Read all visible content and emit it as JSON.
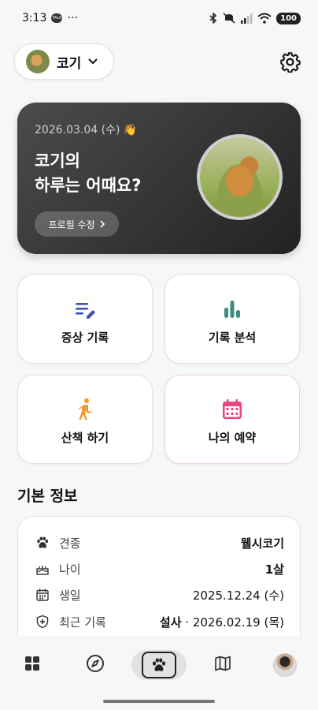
{
  "status_bar": {
    "time": "3:13",
    "talk_badge": "TALK",
    "more": "···",
    "battery": "100"
  },
  "pet_selector": {
    "name": "코기"
  },
  "hero": {
    "date": "2026.03.04 (수) 👋",
    "greeting_line1": "코기의",
    "greeting_line2": "하루는 어때요?",
    "edit_button": "프로필 수정"
  },
  "actions": [
    {
      "label": "증상 기록",
      "icon": "symptom-note-icon",
      "color": "#3f51b5"
    },
    {
      "label": "기록 분석",
      "icon": "bar-chart-icon",
      "color": "#3d8c7d"
    },
    {
      "label": "산책 하기",
      "icon": "walking-person-icon",
      "color": "#f29a2e"
    },
    {
      "label": "나의 예약",
      "icon": "calendar-icon",
      "color": "#e8457a"
    }
  ],
  "basic_info": {
    "title": "기본 정보",
    "rows": [
      {
        "label": "견종",
        "value": "웰시코기"
      },
      {
        "label": "나이",
        "value": "1살"
      },
      {
        "label": "생일",
        "value": "2025.12.24 (수)"
      },
      {
        "label": "최근 기록",
        "value_bold": "설사",
        "value": " · 2026.02.19 (목)"
      }
    ]
  },
  "bottom_nav": {
    "items": [
      "home-grid-icon",
      "compass-icon",
      "paw-icon",
      "map-icon",
      "profile-avatar"
    ],
    "active": "paw-icon"
  }
}
